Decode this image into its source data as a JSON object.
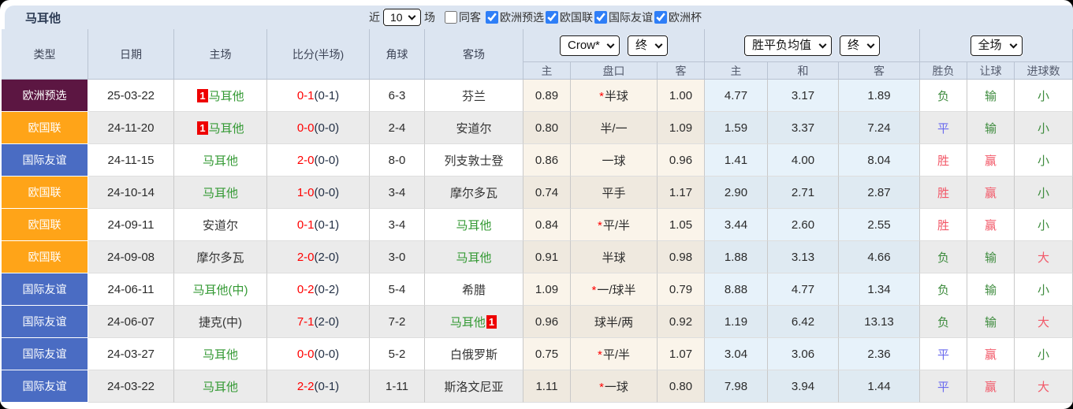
{
  "title": "马耳他",
  "badge_text": "1",
  "controls": {
    "recent_label": "近",
    "recent_value": "10",
    "matches_label": "场",
    "same_opponent": {
      "label": "同客",
      "checked": false
    },
    "filters": [
      {
        "label": "欧洲预选",
        "checked": true
      },
      {
        "label": "欧国联",
        "checked": true
      },
      {
        "label": "国际友谊",
        "checked": true
      },
      {
        "label": "欧洲杯",
        "checked": true
      }
    ]
  },
  "table": {
    "main_headers": [
      "类型",
      "日期",
      "主场",
      "比分(半场)",
      "角球",
      "客场"
    ],
    "selects": {
      "bookmaker": "Crow*",
      "odds_state": "终",
      "avg": "胜平负均值",
      "avg_state": "终",
      "scope": "全场"
    },
    "sub_headers": {
      "odds_home": "主",
      "odds_handicap": "盘口",
      "odds_away": "客",
      "avg_home": "主",
      "avg_draw": "和",
      "avg_away": "客",
      "result_wdl": "胜负",
      "result_handicap": "让球",
      "result_goals": "进球数"
    },
    "rows": [
      {
        "type": "欧洲预选",
        "type_color": "maroon",
        "date": "25-03-22",
        "home": {
          "text": "马耳他",
          "green": true,
          "badge": "before"
        },
        "score_full": "0-1",
        "score_half": "(0-1)",
        "corners": "6-3",
        "away": {
          "text": "芬兰",
          "green": false,
          "badge": null
        },
        "odds_home": "0.89",
        "handicap": "半球",
        "handicap_star": true,
        "odds_away": "1.00",
        "avg_home": "4.77",
        "avg_draw": "3.17",
        "avg_away": "1.89",
        "wdl": {
          "text": "负",
          "color": "green"
        },
        "let": {
          "text": "输",
          "color": "green"
        },
        "goals": {
          "text": "小",
          "color": "green"
        }
      },
      {
        "type": "欧国联",
        "type_color": "orange",
        "date": "24-11-20",
        "home": {
          "text": "马耳他",
          "green": true,
          "badge": "before"
        },
        "score_full": "0-0",
        "score_half": "(0-0)",
        "corners": "2-4",
        "away": {
          "text": "安道尔",
          "green": false,
          "badge": null
        },
        "odds_home": "0.80",
        "handicap": "半/一",
        "handicap_star": false,
        "odds_away": "1.09",
        "avg_home": "1.59",
        "avg_draw": "3.37",
        "avg_away": "7.24",
        "wdl": {
          "text": "平",
          "color": "blue"
        },
        "let": {
          "text": "输",
          "color": "green"
        },
        "goals": {
          "text": "小",
          "color": "green"
        }
      },
      {
        "type": "国际友谊",
        "type_color": "blue",
        "date": "24-11-15",
        "home": {
          "text": "马耳他",
          "green": true,
          "badge": null
        },
        "score_full": "2-0",
        "score_half": "(0-0)",
        "corners": "8-0",
        "away": {
          "text": "列支敦士登",
          "green": false,
          "badge": null
        },
        "odds_home": "0.86",
        "handicap": "一球",
        "handicap_star": false,
        "odds_away": "0.96",
        "avg_home": "1.41",
        "avg_draw": "4.00",
        "avg_away": "8.04",
        "wdl": {
          "text": "胜",
          "color": "red"
        },
        "let": {
          "text": "赢",
          "color": "red"
        },
        "goals": {
          "text": "小",
          "color": "green"
        }
      },
      {
        "type": "欧国联",
        "type_color": "orange",
        "date": "24-10-14",
        "home": {
          "text": "马耳他",
          "green": true,
          "badge": null
        },
        "score_full": "1-0",
        "score_half": "(0-0)",
        "corners": "3-4",
        "away": {
          "text": "摩尔多瓦",
          "green": false,
          "badge": null
        },
        "odds_home": "0.74",
        "handicap": "平手",
        "handicap_star": false,
        "odds_away": "1.17",
        "avg_home": "2.90",
        "avg_draw": "2.71",
        "avg_away": "2.87",
        "wdl": {
          "text": "胜",
          "color": "red"
        },
        "let": {
          "text": "赢",
          "color": "red"
        },
        "goals": {
          "text": "小",
          "color": "green"
        }
      },
      {
        "type": "欧国联",
        "type_color": "orange",
        "date": "24-09-11",
        "home": {
          "text": "安道尔",
          "green": false,
          "badge": null
        },
        "score_full": "0-1",
        "score_half": "(0-1)",
        "corners": "3-4",
        "away": {
          "text": "马耳他",
          "green": true,
          "badge": null
        },
        "odds_home": "0.84",
        "handicap": "平/半",
        "handicap_star": true,
        "odds_away": "1.05",
        "avg_home": "3.44",
        "avg_draw": "2.60",
        "avg_away": "2.55",
        "wdl": {
          "text": "胜",
          "color": "red"
        },
        "let": {
          "text": "赢",
          "color": "red"
        },
        "goals": {
          "text": "小",
          "color": "green"
        }
      },
      {
        "type": "欧国联",
        "type_color": "orange",
        "date": "24-09-08",
        "home": {
          "text": "摩尔多瓦",
          "green": false,
          "badge": null
        },
        "score_full": "2-0",
        "score_half": "(2-0)",
        "corners": "3-0",
        "away": {
          "text": "马耳他",
          "green": true,
          "badge": null
        },
        "odds_home": "0.91",
        "handicap": "半球",
        "handicap_star": false,
        "odds_away": "0.98",
        "avg_home": "1.88",
        "avg_draw": "3.13",
        "avg_away": "4.66",
        "wdl": {
          "text": "负",
          "color": "green"
        },
        "let": {
          "text": "输",
          "color": "green"
        },
        "goals": {
          "text": "大",
          "color": "red"
        }
      },
      {
        "type": "国际友谊",
        "type_color": "blue",
        "date": "24-06-11",
        "home": {
          "text": "马耳他(中)",
          "green": true,
          "badge": null
        },
        "score_full": "0-2",
        "score_half": "(0-2)",
        "corners": "5-4",
        "away": {
          "text": "希腊",
          "green": false,
          "badge": null
        },
        "odds_home": "1.09",
        "handicap": "一/球半",
        "handicap_star": true,
        "odds_away": "0.79",
        "avg_home": "8.88",
        "avg_draw": "4.77",
        "avg_away": "1.34",
        "wdl": {
          "text": "负",
          "color": "green"
        },
        "let": {
          "text": "输",
          "color": "green"
        },
        "goals": {
          "text": "小",
          "color": "green"
        }
      },
      {
        "type": "国际友谊",
        "type_color": "blue",
        "date": "24-06-07",
        "home": {
          "text": "捷克(中)",
          "green": false,
          "badge": null
        },
        "score_full": "7-1",
        "score_half": "(2-0)",
        "corners": "7-2",
        "away": {
          "text": "马耳他",
          "green": true,
          "badge": "after"
        },
        "odds_home": "0.96",
        "handicap": "球半/两",
        "handicap_star": false,
        "odds_away": "0.92",
        "avg_home": "1.19",
        "avg_draw": "6.42",
        "avg_away": "13.13",
        "wdl": {
          "text": "负",
          "color": "green"
        },
        "let": {
          "text": "输",
          "color": "green"
        },
        "goals": {
          "text": "大",
          "color": "red"
        }
      },
      {
        "type": "国际友谊",
        "type_color": "blue",
        "date": "24-03-27",
        "home": {
          "text": "马耳他",
          "green": true,
          "badge": null
        },
        "score_full": "0-0",
        "score_half": "(0-0)",
        "corners": "5-2",
        "away": {
          "text": "白俄罗斯",
          "green": false,
          "badge": null
        },
        "odds_home": "0.75",
        "handicap": "平/半",
        "handicap_star": true,
        "odds_away": "1.07",
        "avg_home": "3.04",
        "avg_draw": "3.06",
        "avg_away": "2.36",
        "wdl": {
          "text": "平",
          "color": "blue"
        },
        "let": {
          "text": "赢",
          "color": "red"
        },
        "goals": {
          "text": "小",
          "color": "green"
        }
      },
      {
        "type": "国际友谊",
        "type_color": "blue",
        "date": "24-03-22",
        "home": {
          "text": "马耳他",
          "green": true,
          "badge": null
        },
        "score_full": "2-2",
        "score_half": "(0-1)",
        "corners": "1-11",
        "away": {
          "text": "斯洛文尼亚",
          "green": false,
          "badge": null
        },
        "odds_home": "1.11",
        "handicap": "一球",
        "handicap_star": true,
        "odds_away": "0.80",
        "avg_home": "7.98",
        "avg_draw": "3.94",
        "avg_away": "1.44",
        "wdl": {
          "text": "平",
          "color": "blue"
        },
        "let": {
          "text": "赢",
          "color": "red"
        },
        "goals": {
          "text": "大",
          "color": "red"
        }
      }
    ]
  },
  "colors": {
    "accent_checkbox": "#2e7ef7",
    "header_bg": "#dce5f1",
    "row_alt_bg": "#ebebeb",
    "odds_bg": "#faf4ea",
    "odds_bg_alt": "#efe9df",
    "avg_bg": "#e7f2fa",
    "avg_bg_alt": "#dfeaf2",
    "type_maroon": "#5c1642",
    "type_orange": "#ffa418",
    "type_blue": "#4a6cc3",
    "team_green": "#339933",
    "score_red": "#ff0000",
    "badge_red": "#ee0000",
    "result_green": "#3d8b3d",
    "result_red": "#f25868",
    "result_blue": "#6a6aee"
  }
}
